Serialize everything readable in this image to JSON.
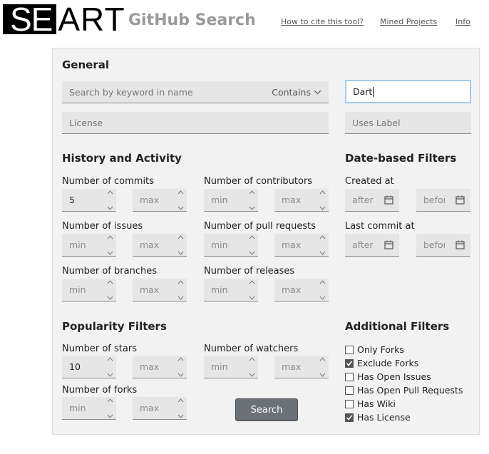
{
  "header": {
    "logo_part1": "SE",
    "logo_part2": "ART",
    "app_title": "GitHub Search",
    "links": [
      "How to cite this tool?",
      "Mined Projects",
      "Info"
    ]
  },
  "general": {
    "title": "General",
    "keyword_placeholder": "Search by keyword in name",
    "match_mode": "Contains",
    "language_value": "Dart",
    "license_placeholder": "License",
    "label_placeholder": "Uses Label"
  },
  "history": {
    "title": "History and Activity",
    "commits_label": "Number of commits",
    "commits_min": "5",
    "commits_max": "max",
    "contributors_label": "Number of contributors",
    "contributors_min": "min",
    "contributors_max": "max",
    "issues_label": "Number of issues",
    "issues_min": "min",
    "issues_max": "max",
    "pulls_label": "Number of pull requests",
    "pulls_min": "min",
    "pulls_max": "max",
    "branches_label": "Number of branches",
    "branches_min": "min",
    "branches_max": "max",
    "releases_label": "Number of releases",
    "releases_min": "min",
    "releases_max": "max"
  },
  "dates": {
    "title": "Date-based Filters",
    "created_label": "Created at",
    "created_after": "after",
    "created_before": "before",
    "commit_label": "Last commit at",
    "commit_after": "after",
    "commit_before": "before"
  },
  "popularity": {
    "title": "Popularity Filters",
    "stars_label": "Number of stars",
    "stars_min": "10",
    "stars_max": "max",
    "watchers_label": "Number of watchers",
    "watchers_min": "min",
    "watchers_max": "max",
    "forks_label": "Number of forks",
    "forks_min": "min",
    "forks_max": "max"
  },
  "additional": {
    "title": "Additional Filters",
    "options": [
      {
        "label": "Only Forks",
        "checked": false
      },
      {
        "label": "Exclude Forks",
        "checked": true
      },
      {
        "label": "Has Open Issues",
        "checked": false
      },
      {
        "label": "Has Open Pull Requests",
        "checked": false
      },
      {
        "label": "Has Wiki",
        "checked": false
      },
      {
        "label": "Has License",
        "checked": true
      }
    ]
  },
  "search_button": "Search"
}
